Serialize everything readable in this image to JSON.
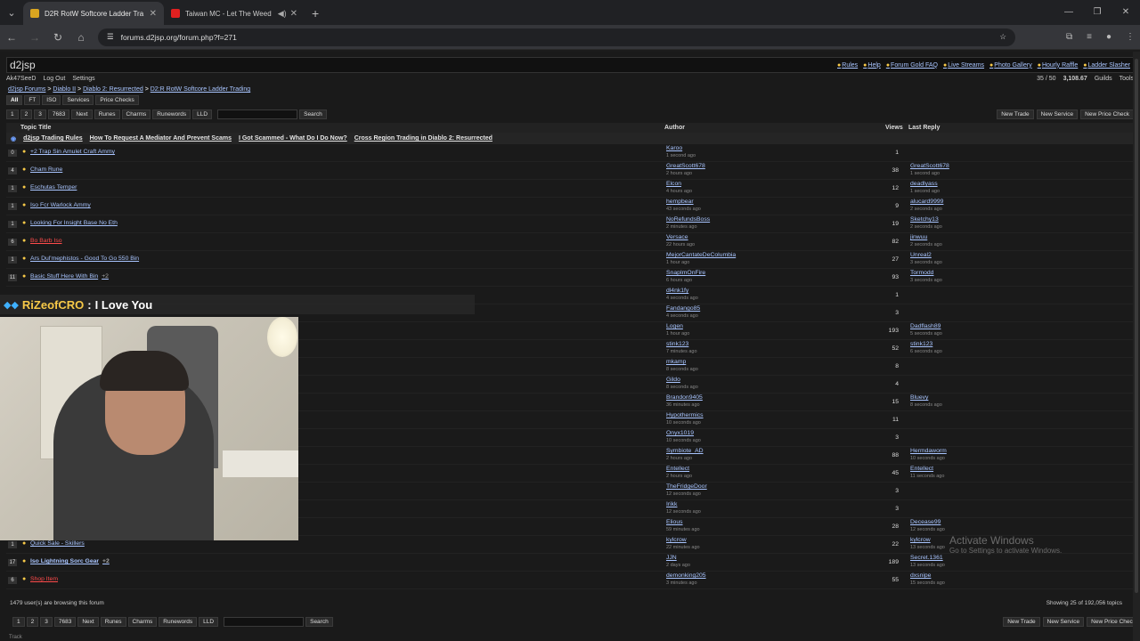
{
  "browser": {
    "tabs": [
      {
        "title": "D2R RotW Softcore Ladder Tra",
        "active": true
      },
      {
        "title": "Taiwan MC - Let The Weed",
        "active": false
      }
    ],
    "url": "forums.d2jsp.org/forum.php?f=271"
  },
  "site": {
    "logo": "d2jsp",
    "top_links": [
      "Rules",
      "Help",
      "Forum Gold FAQ",
      "Live Streams",
      "Photo Gallery",
      "Hourly Raffle",
      "Ladder Slasher"
    ],
    "user": "Ak47SeeD",
    "logout": "Log Out",
    "settings": "Settings",
    "count": "35 / 50",
    "gold": "3,108.67",
    "guilds": "Guilds",
    "tools": "Tools"
  },
  "breadcrumb": [
    "d2jsp Forums",
    "Diablo II",
    "Diablo 2: Resurrected",
    "D2:R RotW Softcore Ladder Trading"
  ],
  "filters": [
    "All",
    "FT",
    "ISO",
    "Services",
    "Price Checks"
  ],
  "pager": {
    "pages": [
      "1",
      "2",
      "3",
      "7683",
      "Next",
      "Runes",
      "Charms",
      "Runewords",
      "LLD"
    ],
    "search": "Search",
    "actions": [
      "New Trade",
      "New Service",
      "New Price Check"
    ]
  },
  "table_header": {
    "topic": "Topic Title",
    "author": "Author",
    "views": "Views",
    "last_reply": "Last Reply"
  },
  "sticky_links": [
    "d2jsp Trading Rules",
    "How To Request A Mediator And Prevent Scams",
    "I Got Scammed - What Do I Do Now?",
    "Cross Region Trading in Diablo 2: Resurrected"
  ],
  "rows": [
    {
      "num": "0",
      "title": "+2 Trap Sin Amulet Craft Ammy",
      "author": "Karoo",
      "atime": "1 second ago",
      "views": "1",
      "lr": "",
      "lrtime": "",
      "style": ""
    },
    {
      "num": "4",
      "title": "Cham Rune",
      "author": "GreatScott678",
      "atime": "2 hours ago",
      "views": "38",
      "lr": "GreatScott678",
      "lrtime": "1 second ago",
      "style": ""
    },
    {
      "num": "1",
      "title": "Eschutas Temper",
      "author": "Elcon",
      "atime": "4 hours ago",
      "views": "12",
      "lr": "deadlyass",
      "lrtime": "1 second ago",
      "style": ""
    },
    {
      "num": "1",
      "title": "Iso Fcr Warlock Ammy",
      "author": "hempbear",
      "atime": "43 seconds ago",
      "views": "9",
      "lr": "alucard9999",
      "lrtime": "2 seconds ago",
      "style": ""
    },
    {
      "num": "1",
      "title": "Looking For Insight Base No Eth",
      "author": "NoRefundsBoss",
      "atime": "2 minutes ago",
      "views": "19",
      "lr": "Sketchy13",
      "lrtime": "2 seconds ago",
      "style": ""
    },
    {
      "num": "6",
      "title": "Bo Barb Iso",
      "author": "Versace",
      "atime": "22 hours ago",
      "views": "82",
      "lr": "jinwuu",
      "lrtime": "2 seconds ago",
      "style": "red"
    },
    {
      "num": "1",
      "title": "Ars Dul'mephistos - Good To Go 550 Bin",
      "author": "MejorCantateDeColumbia",
      "atime": "1 hour ago",
      "views": "27",
      "lr": "Unreal2",
      "lrtime": "3 seconds ago",
      "style": ""
    },
    {
      "num": "11",
      "title": "Basic Stuff Here With Bin",
      "author": "SnapImOnFire",
      "atime": "6 hours ago",
      "views": "93",
      "lr": "Tormodd",
      "lrtime": "3 seconds ago",
      "style": "",
      "pg": "+2"
    },
    {
      "num": "",
      "title": "",
      "author": "dl4nk1fy",
      "atime": "4 seconds ago",
      "views": "1",
      "lr": "",
      "lrtime": "",
      "style": ""
    },
    {
      "num": "",
      "title": "",
      "author": "Fandango85",
      "atime": "4 seconds ago",
      "views": "3",
      "lr": "",
      "lrtime": "",
      "style": ""
    },
    {
      "num": "",
      "title": "",
      "author": "Logen",
      "atime": "1 hour ago",
      "views": "193",
      "lr": "Dadflash89",
      "lrtime": "5 seconds ago",
      "style": ""
    },
    {
      "num": "",
      "title": "",
      "author": "stink123",
      "atime": "7 minutes ago",
      "views": "52",
      "lr": "stink123",
      "lrtime": "6 seconds ago",
      "style": ""
    },
    {
      "num": "",
      "title": "",
      "author": "mkamp",
      "atime": "8 seconds ago",
      "views": "8",
      "lr": "",
      "lrtime": "",
      "style": ""
    },
    {
      "num": "",
      "title": "",
      "author": "Gildo",
      "atime": "8 seconds ago",
      "views": "4",
      "lr": "",
      "lrtime": "",
      "style": ""
    },
    {
      "num": "",
      "title": "",
      "author": "Brandon9405",
      "atime": "36 minutes ago",
      "views": "15",
      "lr": "Bluevy",
      "lrtime": "8 seconds ago",
      "style": ""
    },
    {
      "num": "",
      "title": "",
      "author": "Hypothermics",
      "atime": "10 seconds ago",
      "views": "11",
      "lr": "",
      "lrtime": "",
      "style": ""
    },
    {
      "num": "",
      "title": "",
      "author": "Onyx1019",
      "atime": "10 seconds ago",
      "views": "3",
      "lr": "",
      "lrtime": "",
      "style": ""
    },
    {
      "num": "",
      "title": "",
      "author": "Symbiote_AD",
      "atime": "2 hours ago",
      "views": "88",
      "lr": "Hermdaworm",
      "lrtime": "10 seconds ago",
      "style": ""
    },
    {
      "num": "",
      "title": "",
      "author": "Entellect",
      "atime": "2 hours ago",
      "views": "45",
      "lr": "Entellect",
      "lrtime": "11 seconds ago",
      "style": ""
    },
    {
      "num": "",
      "title": "",
      "author": "TheFridgeDoor",
      "atime": "12 seconds ago",
      "views": "3",
      "lr": "",
      "lrtime": "",
      "style": ""
    },
    {
      "num": "",
      "title": "",
      "author": "Irikk",
      "atime": "12 seconds ago",
      "views": "3",
      "lr": "",
      "lrtime": "",
      "style": ""
    },
    {
      "num": "",
      "title": "",
      "author": "Elious",
      "atime": "59 minutes ago",
      "views": "28",
      "lr": "Decease99",
      "lrtime": "12 seconds ago",
      "style": ""
    },
    {
      "num": "1",
      "title": "Quick Sale - Skillers",
      "author": "kylcrow",
      "atime": "22 minutes ago",
      "views": "22",
      "lr": "kylcrow",
      "lrtime": "13 seconds ago",
      "style": ""
    },
    {
      "num": "17",
      "title": "Iso Lightning Sorc Gear",
      "author": "JJN",
      "atime": "2 days ago",
      "views": "189",
      "lr": "Secret.1361",
      "lrtime": "13 seconds ago",
      "style": "bold",
      "pg": "+2"
    },
    {
      "num": "6",
      "title": "Shop Item",
      "author": "demonking205",
      "atime": "3 minutes ago",
      "views": "55",
      "lr": "dxsnipe",
      "lrtime": "15 seconds ago",
      "style": "red"
    }
  ],
  "footer": {
    "browsing": "1479 user(s) are browsing this forum",
    "showing": "Showing 25 of 192,056 topics",
    "track": "Track"
  },
  "stream": {
    "chat_user": "RiZeofCRO",
    "chat_sep": ":",
    "chat_msg": "I Love You"
  },
  "os": {
    "activate_title": "Activate Windows",
    "activate_sub": "Go to Settings to activate Windows."
  }
}
